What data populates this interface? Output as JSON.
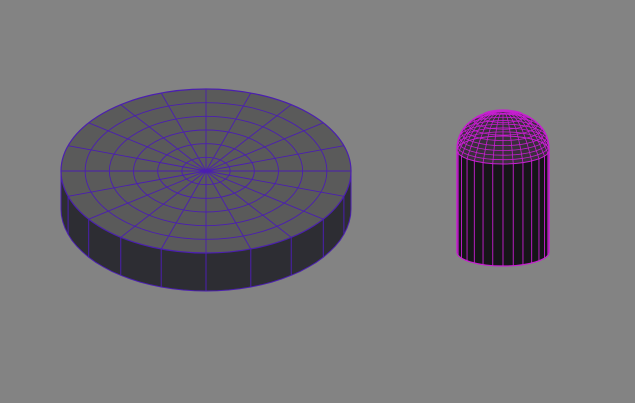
{
  "viewport": {
    "background": "#838383"
  },
  "objects": [
    {
      "name": "cylinder-disc",
      "kind": "cylinder",
      "selected": false,
      "wire_color": "#4b1fb0",
      "face_top": "#5a5a5a",
      "face_side": "#2d2d33",
      "radial_segments": 20,
      "cap_rings": 6
    },
    {
      "name": "capsule",
      "kind": "capsule",
      "selected": true,
      "wire_color": "#c81ed2",
      "face_side": "#151518",
      "face_top": "#3a2f3c",
      "radial_segments": 28,
      "dome_rings": 8
    }
  ]
}
